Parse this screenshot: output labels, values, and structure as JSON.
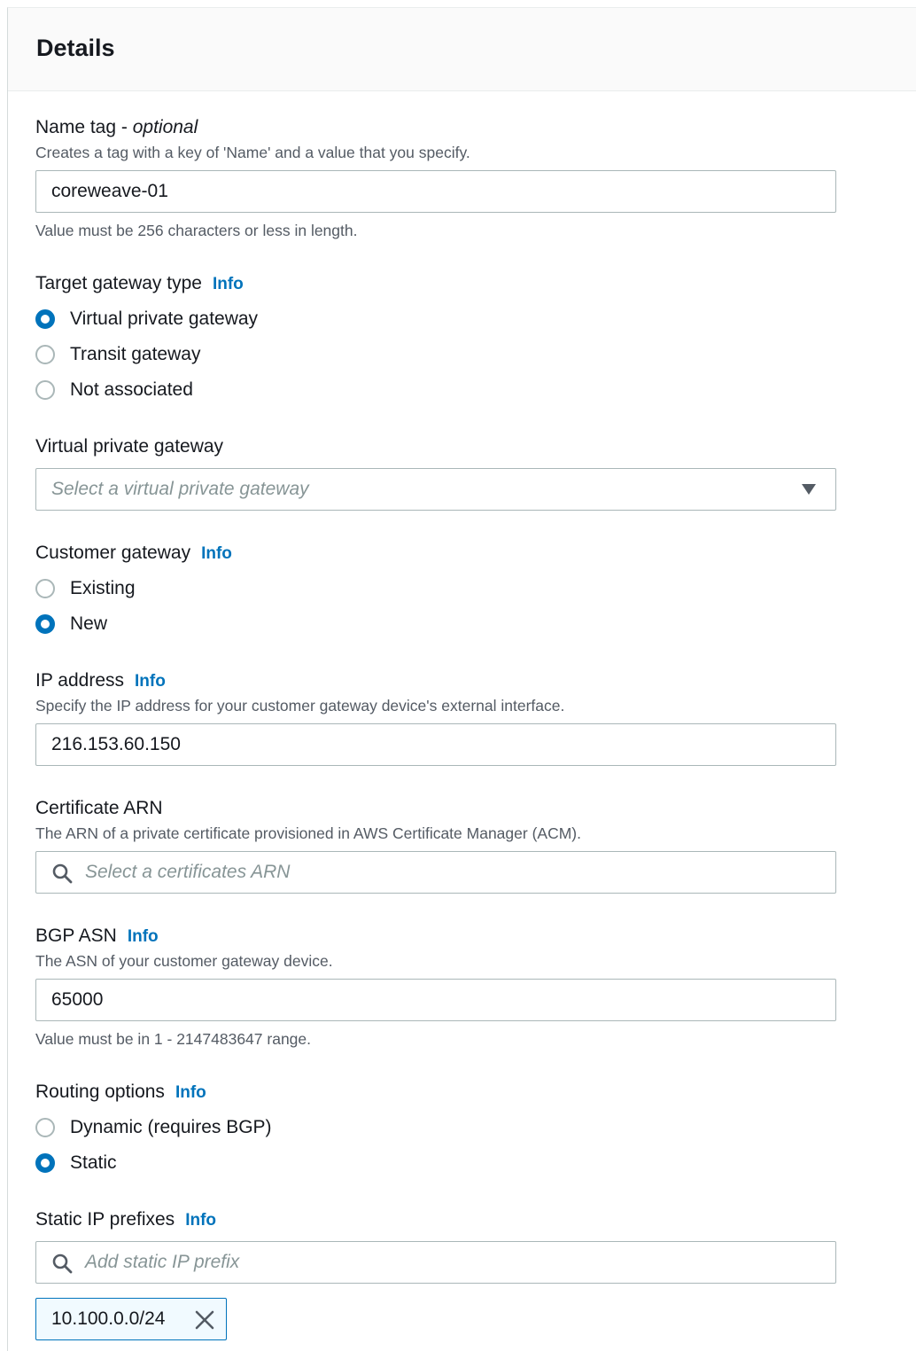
{
  "details": {
    "title": "Details"
  },
  "info_label": "Info",
  "name_tag": {
    "label": "Name tag - ",
    "label_optional": "optional",
    "description": "Creates a tag with a key of 'Name' and a value that you specify.",
    "value": "coreweave-01",
    "constraint": "Value must be 256 characters or less in length."
  },
  "target_gateway": {
    "label": "Target gateway type",
    "options": [
      {
        "label": "Virtual private gateway",
        "selected": true
      },
      {
        "label": "Transit gateway",
        "selected": false
      },
      {
        "label": "Not associated",
        "selected": false
      }
    ]
  },
  "virtual_private_gateway": {
    "label": "Virtual private gateway",
    "placeholder": "Select a virtual private gateway"
  },
  "customer_gateway": {
    "label": "Customer gateway",
    "options": [
      {
        "label": "Existing",
        "selected": false
      },
      {
        "label": "New",
        "selected": true
      }
    ]
  },
  "ip_address": {
    "label": "IP address",
    "description": "Specify the IP address for your customer gateway device's external interface.",
    "value": "216.153.60.150"
  },
  "certificate_arn": {
    "label": "Certificate ARN",
    "description": "The ARN of a private certificate provisioned in AWS Certificate Manager (ACM).",
    "placeholder": "Select a certificates ARN"
  },
  "bgp_asn": {
    "label": "BGP ASN",
    "description": "The ASN of your customer gateway device.",
    "value": "65000",
    "constraint": "Value must be in 1 - 2147483647 range."
  },
  "routing_options": {
    "label": "Routing options",
    "options": [
      {
        "label": "Dynamic (requires BGP)",
        "selected": false
      },
      {
        "label": "Static",
        "selected": true
      }
    ]
  },
  "static_ip_prefixes": {
    "label": "Static IP prefixes",
    "placeholder": "Add static IP prefix",
    "tokens": [
      "10.100.0.0/24"
    ]
  },
  "colors": {
    "accent": "#0073bb",
    "text": "#16191f",
    "secondary": "#545b64",
    "border": "#aab7b8"
  }
}
